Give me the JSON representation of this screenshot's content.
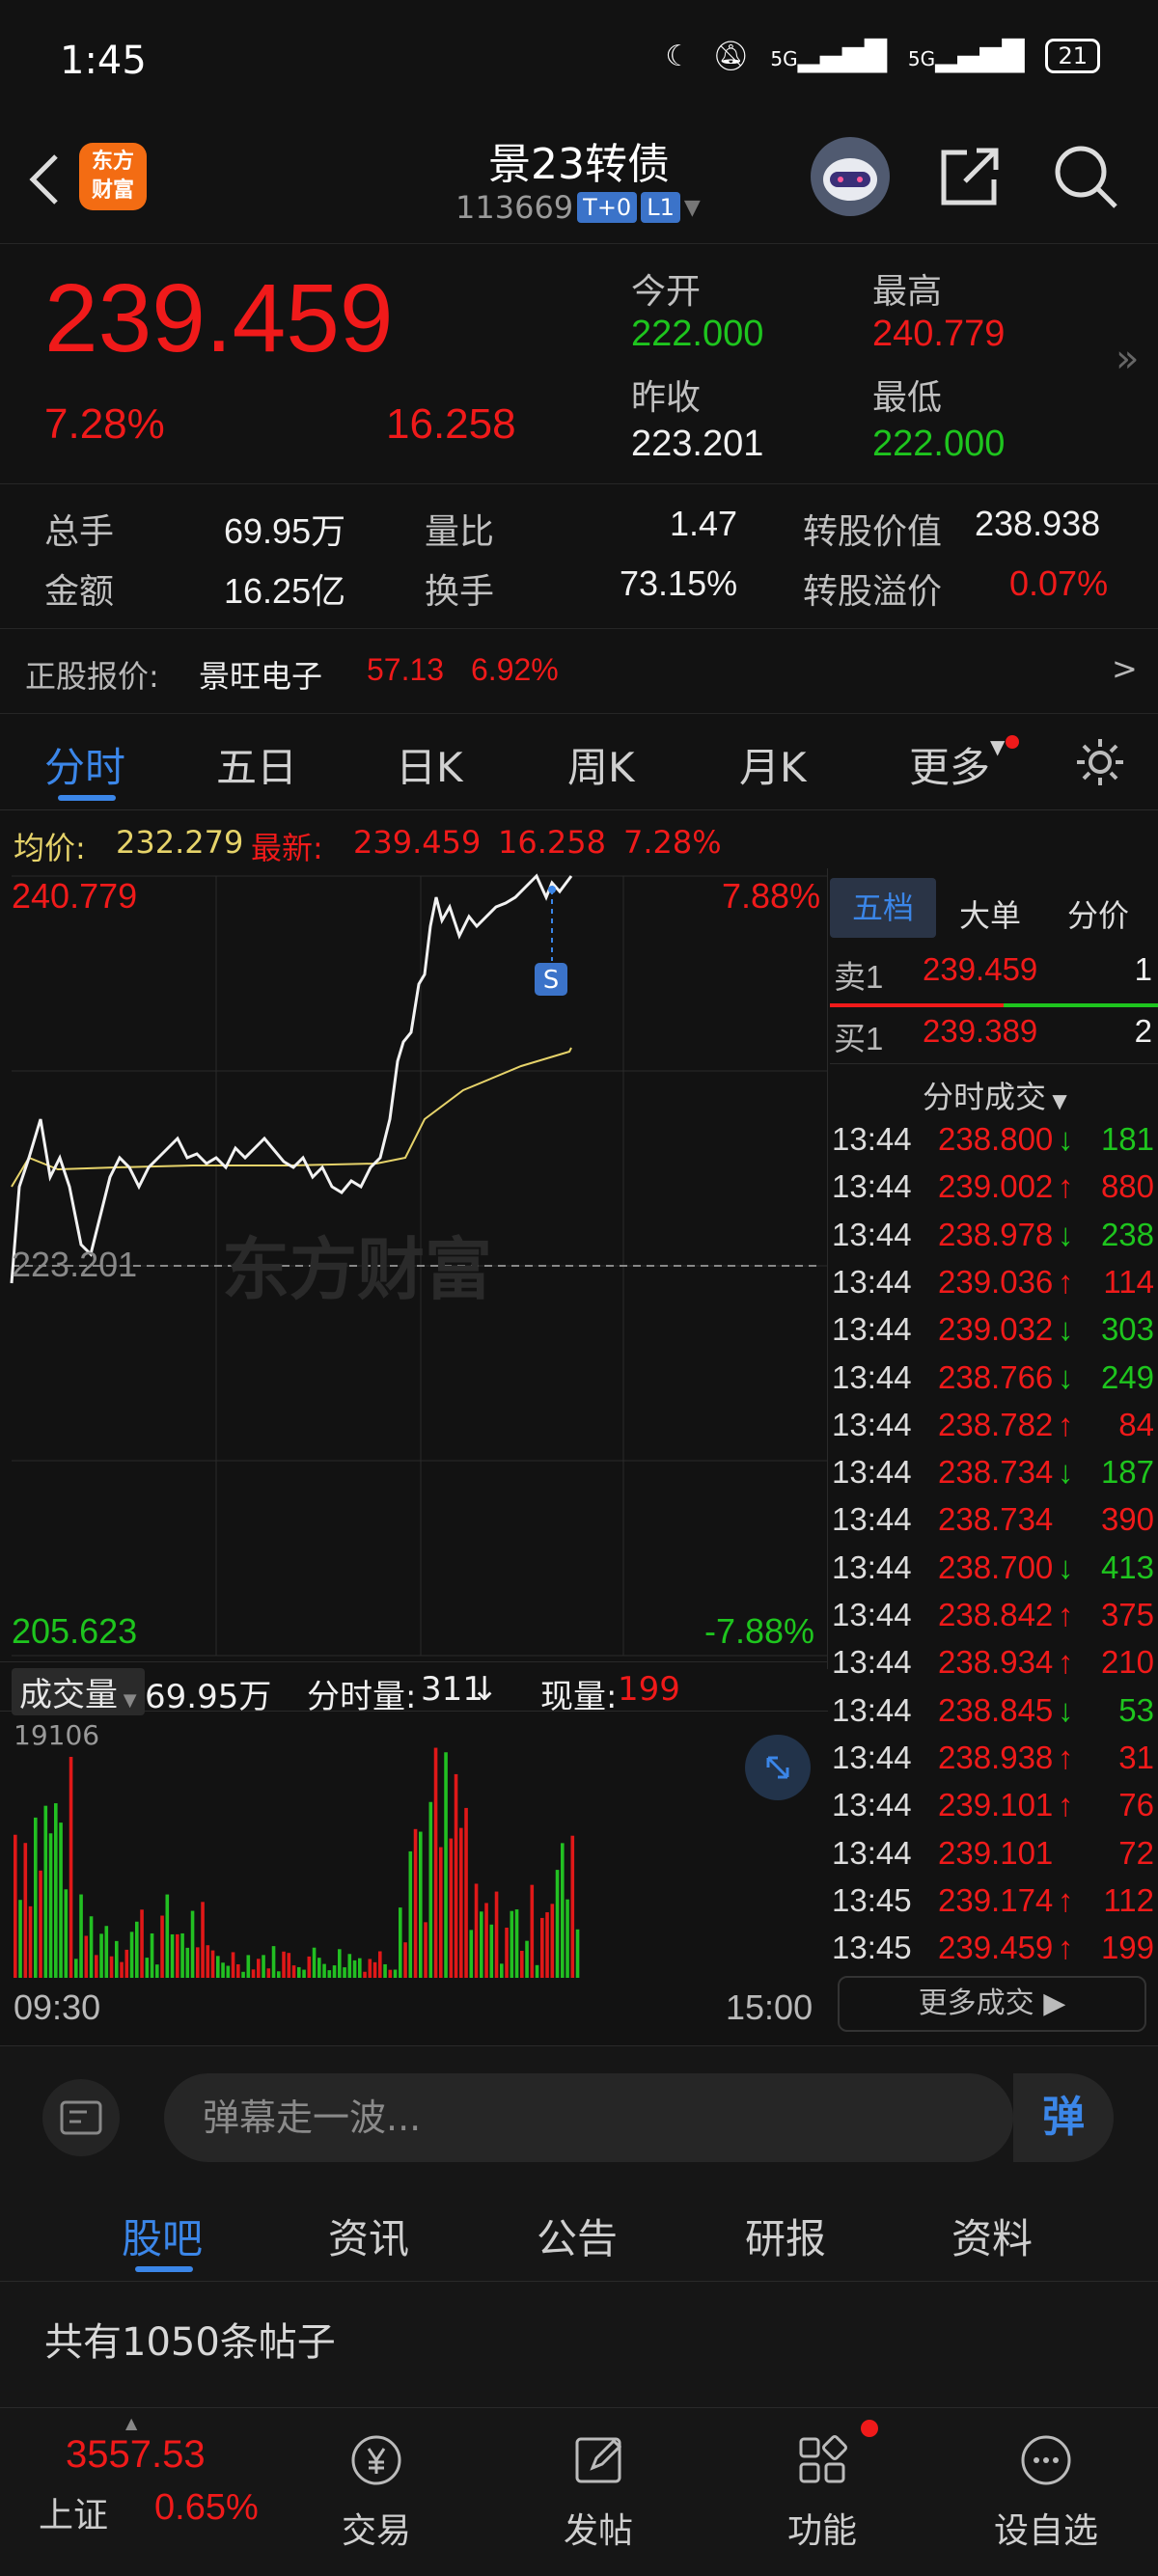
{
  "status_bar": {
    "time": "1:45",
    "net1": "5G",
    "net2": "5G",
    "battery": "21",
    "icons": [
      "moon-icon",
      "mute-icon",
      "signal-icon",
      "signal-icon",
      "battery-icon"
    ]
  },
  "header": {
    "logo_line1": "东方",
    "logo_line2": "财富",
    "title": "景23转债",
    "code": "113669",
    "tag1": "T+0",
    "tag2": "L1"
  },
  "quote": {
    "price": "239.459",
    "change_pct": "7.28%",
    "change": "16.258",
    "open_label": "今开",
    "open": "222.000",
    "high_label": "最高",
    "high": "240.779",
    "prev_close_label": "昨收",
    "prev_close": "223.201",
    "low_label": "最低",
    "low": "222.000"
  },
  "stats": {
    "vol_label": "总手",
    "vol": "69.95万",
    "ratio_label": "量比",
    "ratio": "1.47",
    "conv_value_label": "转股价值",
    "conv_value": "238.938",
    "amount_label": "金额",
    "amount": "16.25亿",
    "turnover_label": "换手",
    "turnover": "73.15%",
    "premium_label": "转股溢价",
    "premium": "0.07%"
  },
  "stock": {
    "label": "正股报价:",
    "name": "景旺电子",
    "price": "57.13",
    "pct": "6.92%",
    "arrow": ">"
  },
  "tabs": [
    "分时",
    "五日",
    "日K",
    "周K",
    "月K",
    "更多"
  ],
  "chart_info": {
    "avg_label": "均价:",
    "avg": "232.279",
    "latest_label": "最新:",
    "latest": "239.459",
    "chg": "16.258",
    "pct": "7.28%"
  },
  "chart_axes": {
    "top_price": "240.779",
    "top_pct": "7.88%",
    "mid_price": "223.201",
    "bottom_price": "205.623",
    "bottom_pct": "-7.88%",
    "watermark": "东方财富",
    "marker": "S"
  },
  "volume": {
    "label": "成交量",
    "total": "69.95万",
    "min_label": "分时量:",
    "min_val": "311",
    "min_arrow": "↓",
    "now_label": "现量:",
    "now_val": "199",
    "max": "19106",
    "start": "09:30",
    "end": "15:00"
  },
  "right_panel": {
    "tabs": [
      "五档",
      "大单",
      "分价"
    ],
    "sell1_label": "卖1",
    "sell1_price": "239.459",
    "sell1_vol": "1",
    "buy1_label": "买1",
    "buy1_price": "239.389",
    "buy1_vol": "2",
    "trades_title": "分时成交",
    "more_trades": "更多成交",
    "trades": [
      {
        "t": "13:44",
        "p": "238.800",
        "d": "↓",
        "v": "181",
        "c": "green"
      },
      {
        "t": "13:44",
        "p": "239.002",
        "d": "↑",
        "v": "880",
        "c": "red"
      },
      {
        "t": "13:44",
        "p": "238.978",
        "d": "↓",
        "v": "238",
        "c": "green"
      },
      {
        "t": "13:44",
        "p": "239.036",
        "d": "↑",
        "v": "114",
        "c": "red"
      },
      {
        "t": "13:44",
        "p": "239.032",
        "d": "↓",
        "v": "303",
        "c": "green"
      },
      {
        "t": "13:44",
        "p": "238.766",
        "d": "↓",
        "v": "249",
        "c": "green"
      },
      {
        "t": "13:44",
        "p": "238.782",
        "d": "↑",
        "v": "84",
        "c": "red"
      },
      {
        "t": "13:44",
        "p": "238.734",
        "d": "↓",
        "v": "187",
        "c": "green"
      },
      {
        "t": "13:44",
        "p": "238.734",
        "d": "",
        "v": "390",
        "c": "red"
      },
      {
        "t": "13:44",
        "p": "238.700",
        "d": "↓",
        "v": "413",
        "c": "green"
      },
      {
        "t": "13:44",
        "p": "238.842",
        "d": "↑",
        "v": "375",
        "c": "red"
      },
      {
        "t": "13:44",
        "p": "238.934",
        "d": "↑",
        "v": "210",
        "c": "red"
      },
      {
        "t": "13:44",
        "p": "238.845",
        "d": "↓",
        "v": "53",
        "c": "green"
      },
      {
        "t": "13:44",
        "p": "238.938",
        "d": "↑",
        "v": "31",
        "c": "red"
      },
      {
        "t": "13:44",
        "p": "239.101",
        "d": "↑",
        "v": "76",
        "c": "red"
      },
      {
        "t": "13:44",
        "p": "239.101",
        "d": "",
        "v": "72",
        "c": "red"
      },
      {
        "t": "13:45",
        "p": "239.174",
        "d": "↑",
        "v": "112",
        "c": "red"
      },
      {
        "t": "13:45",
        "p": "239.459",
        "d": "↑",
        "v": "199",
        "c": "red"
      }
    ]
  },
  "danmu": {
    "placeholder": "弹幕走一波...",
    "button": "弹"
  },
  "feed_tabs": [
    "股吧",
    "资讯",
    "公告",
    "研报",
    "资料"
  ],
  "posts_count": "共有1050条帖子",
  "bottom_nav": {
    "index_value": "3557.53",
    "index_name": "上证",
    "index_pct": "0.65%",
    "items": [
      "交易",
      "发帖",
      "功能",
      "设自选"
    ]
  },
  "colors": {
    "up": "#f01a1a",
    "down": "#1ec51e",
    "accent": "#3b86e8",
    "avg_line": "#e6d36a"
  }
}
